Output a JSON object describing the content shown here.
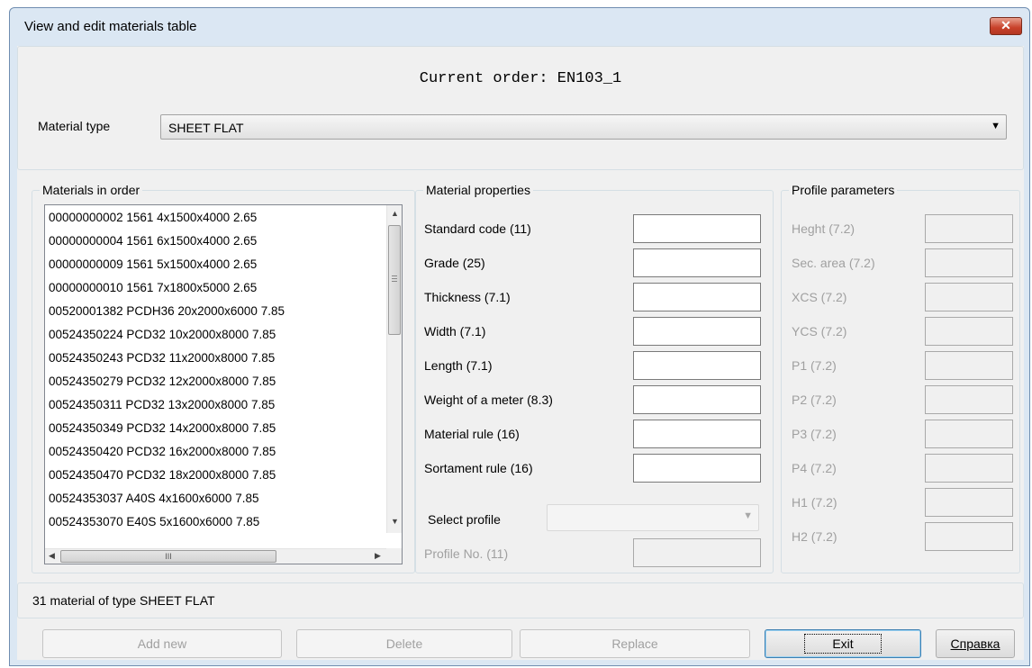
{
  "window": {
    "title": "View and edit materials table",
    "close_label": "✕"
  },
  "header": {
    "current_order": "Current order: EN103_1"
  },
  "material_type": {
    "label": "Material type",
    "value": "SHEET FLAT"
  },
  "materials_in_order": {
    "title": "Materials in order",
    "items": [
      "00000000002 1561 4x1500x4000 2.65",
      "00000000004 1561 6x1500x4000 2.65",
      "00000000009 1561 5x1500x4000 2.65",
      "00000000010 1561 7x1800x5000 2.65",
      "00520001382 PCDH36 20x2000x6000 7.85",
      "00524350224 PCD32 10x2000x8000 7.85",
      "00524350243 PCD32 11x2000x8000 7.85",
      "00524350279 PCD32 12x2000x8000 7.85",
      "00524350311 PCD32 13x2000x8000 7.85",
      "00524350349 PCD32 14x2000x8000 7.85",
      "00524350420 PCD32 16x2000x8000 7.85",
      "00524350470 PCD32 18x2000x8000 7.85",
      "00524353037 A40S 4x1600x6000 7.85",
      "00524353070 E40S 5x1600x6000 7.85"
    ],
    "hscroll_grip": "III"
  },
  "material_properties": {
    "title": "Material properties",
    "fields": [
      {
        "label": "Standard code (11)",
        "value": ""
      },
      {
        "label": "Grade (25)",
        "value": ""
      },
      {
        "label": "Thickness (7.1)",
        "value": ""
      },
      {
        "label": "Width (7.1)",
        "value": ""
      },
      {
        "label": "Length (7.1)",
        "value": ""
      },
      {
        "label": "Weight of a meter (8.3)",
        "value": ""
      },
      {
        "label": "Material rule (16)",
        "value": ""
      },
      {
        "label": "Sortament rule (16)",
        "value": ""
      }
    ],
    "select_profile_label": "Select profile",
    "select_profile_value": "",
    "profile_no_label": "Profile No. (11)",
    "profile_no_value": ""
  },
  "profile_parameters": {
    "title": "Profile parameters",
    "fields": [
      {
        "label": "Heght (7.2)",
        "value": ""
      },
      {
        "label": "Sec. area (7.2)",
        "value": ""
      },
      {
        "label": "XCS (7.2)",
        "value": ""
      },
      {
        "label": "YCS (7.2)",
        "value": ""
      },
      {
        "label": "P1 (7.2)",
        "value": ""
      },
      {
        "label": "P2 (7.2)",
        "value": ""
      },
      {
        "label": "P3 (7.2)",
        "value": ""
      },
      {
        "label": "P4 (7.2)",
        "value": ""
      },
      {
        "label": "H1 (7.2)",
        "value": ""
      },
      {
        "label": "H2 (7.2)",
        "value": ""
      }
    ]
  },
  "status": {
    "text": "31 material of type SHEET FLAT"
  },
  "buttons": {
    "add_new": "Add new",
    "delete": "Delete",
    "replace": "Replace",
    "exit": "Exit",
    "help": "Справка"
  },
  "icons": {
    "dropdown": "chevron-down-icon",
    "close": "close-icon"
  }
}
